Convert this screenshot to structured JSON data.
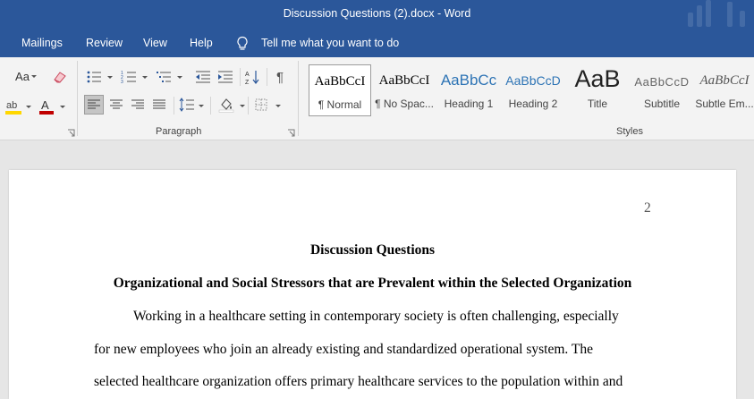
{
  "window": {
    "title": "Discussion Questions (2).docx  -  Word"
  },
  "menu": {
    "items": [
      "Mailings",
      "Review",
      "View",
      "Help"
    ],
    "tell_me": "Tell me what you want to do"
  },
  "ribbon": {
    "paragraph_label": "Paragraph",
    "styles_label": "Styles",
    "font_size_label": "Aa",
    "font_color_accent": "#c00000",
    "highlight_accent": "#ffd700",
    "styles": [
      {
        "preview": "AaBbCcI",
        "name": "¶ Normal",
        "selected": true
      },
      {
        "preview": "AaBbCcI",
        "name": "¶ No Spac...",
        "selected": false
      },
      {
        "preview": "AaBbCc",
        "name": "Heading 1",
        "selected": false
      },
      {
        "preview": "AaBbCcD",
        "name": "Heading 2",
        "selected": false
      },
      {
        "preview": "AaB",
        "name": "Title",
        "selected": false
      },
      {
        "preview": "AaBbCcD",
        "name": "Subtitle",
        "selected": false
      },
      {
        "preview": "AaBbCcI",
        "name": "Subtle Em...",
        "selected": false
      }
    ]
  },
  "document": {
    "page_number": "2",
    "title": "Discussion Questions",
    "heading": "Organizational and Social Stressors that are Prevalent within the Selected Organization",
    "lines": [
      "Working in a healthcare setting in contemporary society is often challenging, especially",
      "for new employees who join an already existing and standardized operational system. The",
      "selected healthcare organization offers primary healthcare services to the population within and"
    ]
  },
  "colors": {
    "titlebar": "#2b579a",
    "ribbon": "#f3f3f3",
    "document_bg": "#e6e6e6"
  }
}
